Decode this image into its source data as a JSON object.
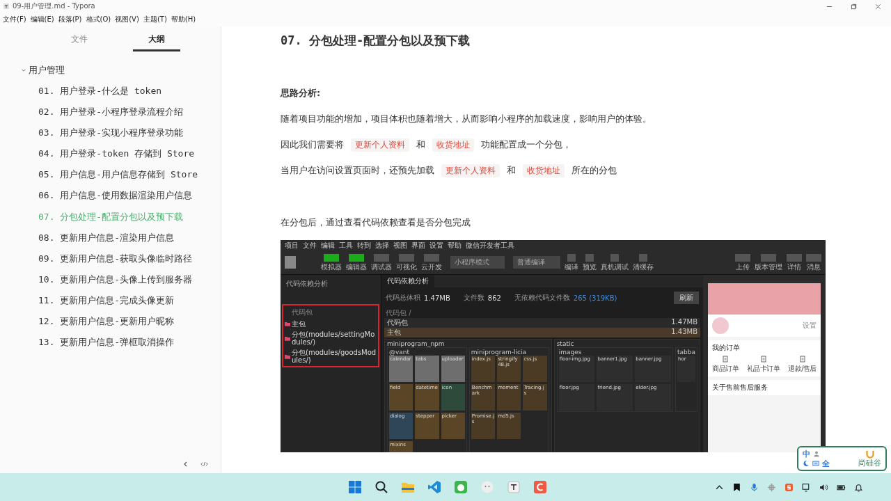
{
  "window": {
    "title": "09-用户管理.md - Typora"
  },
  "menu_bar": [
    "文件(F)",
    "编辑(E)",
    "段落(P)",
    "格式(O)",
    "视图(V)",
    "主题(T)",
    "帮助(H)"
  ],
  "sidebar": {
    "tabs": [
      {
        "label": "文件",
        "selected": false
      },
      {
        "label": "大纲",
        "selected": true
      }
    ],
    "outline": [
      {
        "label": "用户管理",
        "expanded": true,
        "children": [
          {
            "label": "01. 用户登录-什么是 token",
            "selected": false
          },
          {
            "label": "02. 用户登录-小程序登录流程介绍",
            "selected": false
          },
          {
            "label": "03. 用户登录-实现小程序登录功能",
            "selected": false
          },
          {
            "label": "04. 用户登录-token 存储到 Store",
            "selected": false
          },
          {
            "label": "05. 用户信息-用户信息存储到 Store",
            "selected": false
          },
          {
            "label": "06. 用户信息-使用数据渲染用户信息",
            "selected": false
          },
          {
            "label": "07. 分包处理-配置分包以及预下载",
            "selected": true
          },
          {
            "label": "08. 更新用户信息-渲染用户信息",
            "selected": false
          },
          {
            "label": "09. 更新用户信息-获取头像临时路径",
            "selected": false
          },
          {
            "label": "10. 更新用户信息-头像上传到服务器",
            "selected": false
          },
          {
            "label": "11. 更新用户信息-完成头像更新",
            "selected": false
          },
          {
            "label": "12. 更新用户信息-更新用户昵称",
            "selected": false
          },
          {
            "label": "13. 更新用户信息-弹框取消操作",
            "selected": false
          }
        ]
      }
    ]
  },
  "document": {
    "heading": "07. 分包处理-配置分包以及预下载",
    "subheading": "思路分析:",
    "paragraphs": [
      [
        {
          "kind": "text",
          "text": "随着项目功能的增加，项目体积也随着增大，从而影响小程序的加载速度，影响用户的体验。"
        }
      ],
      [
        {
          "kind": "text",
          "text": "因此我们需要将"
        },
        {
          "kind": "code",
          "text": "更新个人资料"
        },
        {
          "kind": "text",
          "text": "和"
        },
        {
          "kind": "code",
          "text": "收货地址"
        },
        {
          "kind": "text",
          "text": "功能配置成一个分包，"
        }
      ],
      [
        {
          "kind": "text",
          "text": "当用户在访问设置页面时，还预先加载"
        },
        {
          "kind": "code",
          "text": "更新个人资料"
        },
        {
          "kind": "text",
          "text": "和"
        },
        {
          "kind": "code",
          "text": "收货地址"
        },
        {
          "kind": "text",
          "text": "所在的分包"
        }
      ]
    ],
    "note": "在分包后，通过查看代码依赖查看是否分包完成"
  },
  "devtools": {
    "menu": [
      "项目",
      "文件",
      "编辑",
      "工具",
      "转到",
      "选择",
      "视图",
      "界面",
      "设置",
      "帮助",
      "微信开发者工具"
    ],
    "toolbar_left": [
      {
        "label": "模拟器",
        "on": true
      },
      {
        "label": "编辑器",
        "on": true
      },
      {
        "label": "调试器",
        "on": false
      },
      {
        "label": "可视化",
        "on": false
      },
      {
        "label": "云开发",
        "on": false
      }
    ],
    "mode_select": "小程序模式",
    "compile_select": "普通编译",
    "toolbar_middle": [
      "编译",
      "预览",
      "真机调试",
      "清缓存"
    ],
    "toolbar_right": [
      "上传",
      "版本管理",
      "详情",
      "消息"
    ],
    "left_panel": {
      "title": "代码依赖分析",
      "root": "代码包",
      "packages": [
        "主包",
        "分包(modules/settingModules/)",
        "分包(modules/goodsModules/)"
      ]
    },
    "tab": "代码依赖分析",
    "stats": [
      {
        "label": "代码总体积",
        "value": "1.47MB",
        "highlighted": false
      },
      {
        "label": "文件数",
        "value": "862",
        "highlighted": false
      },
      {
        "label": "无依赖代码文件数",
        "value": "265 (319KB)",
        "highlighted": true
      }
    ],
    "refresh_button": "刷新",
    "breadcrumb": "代码包 /",
    "treemap": {
      "root": {
        "name": "代码包",
        "size": "1.47MB"
      },
      "main": {
        "name": "主包",
        "size": "1.43MB"
      },
      "groups": [
        {
          "name": "miniprogram_npm",
          "children": [
            {
              "name": "@vant",
              "tiles": [
                {
                  "name": "calendar",
                  "color": "#6e6e6e"
                },
                {
                  "name": "tabs",
                  "color": "#6e6e6e"
                },
                {
                  "name": "uploader",
                  "color": "#6e6e6e"
                },
                {
                  "name": "field",
                  "color": "#5a4527"
                },
                {
                  "name": "datetime",
                  "color": "#5a4527"
                },
                {
                  "name": "icon",
                  "color": "#2e4a3a"
                },
                {
                  "name": "dialog",
                  "color": "#2e4658"
                },
                {
                  "name": "stepper",
                  "color": "#5a4527"
                },
                {
                  "name": "picker",
                  "color": "#5a4527"
                },
                {
                  "name": "mixins",
                  "color": "#5a4527"
                }
              ]
            },
            {
              "name": "miniprogram-licia",
              "tiles": [
                {
                  "name": "index.js",
                  "color": "#4b3b25"
                },
                {
                  "name": "stringify48.js",
                  "color": "#4b3b25"
                },
                {
                  "name": "css.js",
                  "color": "#4b3b25"
                },
                {
                  "name": "Benchmark",
                  "color": "#4b3b25"
                },
                {
                  "name": "moment",
                  "color": "#4b3b25"
                },
                {
                  "name": "Tracing.js",
                  "color": "#4b3b25"
                },
                {
                  "name": "Promise.js",
                  "color": "#4b3b25"
                },
                {
                  "name": "md5.js",
                  "color": "#4b3b25"
                }
              ]
            }
          ]
        },
        {
          "name": "static",
          "children": [
            {
              "name": "images",
              "tiles": [
                {
                  "name": "floor-img.jpg",
                  "color": "#2e2e2e"
                },
                {
                  "name": "banner1.jpg",
                  "color": "#2e2e2e"
                },
                {
                  "name": "banner.jpg",
                  "color": "#2e2e2e"
                },
                {
                  "name": "floor.jpg",
                  "color": "#2e2e2e"
                },
                {
                  "name": "friend.jpg",
                  "color": "#2e2e2e"
                },
                {
                  "name": "elder.jpg",
                  "color": "#2e2e2e"
                }
              ]
            },
            {
              "name": "tabba",
              "tiles": [
                {
                  "name": "hor",
                  "color": "#2e2e2e"
                }
              ]
            }
          ]
        }
      ]
    },
    "phone": {
      "user_action": "设置",
      "orders_title": "我的订单",
      "order_items": [
        "商品订单",
        "礼品卡订单",
        "退款/售后"
      ],
      "service_title": "关于售前售后服务"
    }
  },
  "ime": {
    "mode": "中",
    "width": "全",
    "brand": "尚硅谷"
  }
}
